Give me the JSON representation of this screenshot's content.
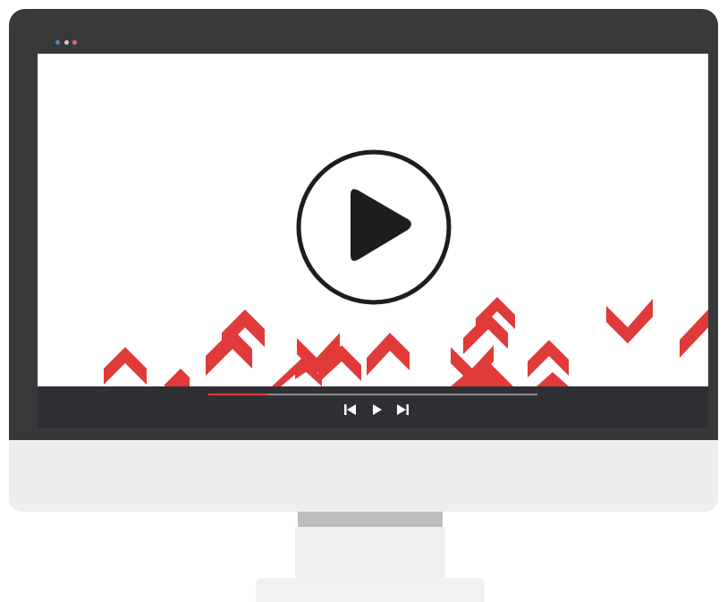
{
  "colors": {
    "monitor_frame": "#37383a",
    "control_bar": "#2f3033",
    "screen": "#ffffff",
    "accent_red": "#e03a3a",
    "play_icon": "#1d1d1d",
    "progress_track": "#8a8c90",
    "bezel": "#eeeeed",
    "window_dot_blue": "#4b8bd1",
    "window_dot_gray": "#c9c9c9",
    "window_dot_red": "#e06c75"
  },
  "player": {
    "progress_fraction": 0.18,
    "icons": {
      "big_play": "play-circle-icon",
      "prev": "skip-back-icon",
      "play": "play-icon",
      "next": "skip-forward-icon"
    }
  }
}
